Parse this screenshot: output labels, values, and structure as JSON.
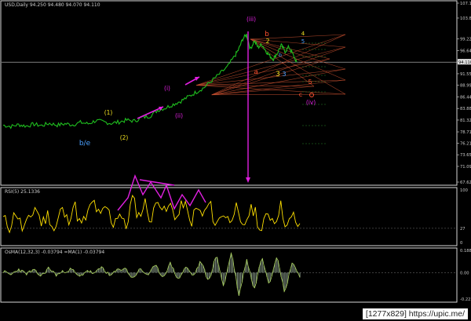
{
  "window": {
    "symbol_header": "USD,Daily  94.250  94.480  94.070  94.110",
    "rsi_header": "RSI(5) 25.1336",
    "macd_header": "OsMA(12,32,3) -0.03794  =MA(1) -0.03794"
  },
  "watermark": "[1277x829] https://upic.me/",
  "colors": {
    "background": "#000000",
    "price_line": "#1fbf1f",
    "rsi_line": "#ffe000",
    "macd_hist": "#7a8a7a",
    "macd_line": "#a8d05a",
    "magenta": "#e020e0",
    "wave_yellow": "#f0e020",
    "wave_blue": "#4aa0ff",
    "wave_red": "#ff5030",
    "fan_lines": "#c85030"
  },
  "chart_data": [
    {
      "type": "line",
      "panel": "price",
      "series_name": "USD Daily close",
      "ylim": [
        67.623,
        107.14
      ],
      "y_ticks": [
        "107.140",
        "103.850",
        "99.225",
        "96.646",
        "94.110",
        "91.552",
        "88.998",
        "86.440",
        "83.880",
        "81.322",
        "78.710",
        "76.210",
        "73.651",
        "71.090",
        "67.623"
      ],
      "current_price_label": "94.110",
      "x": [
        0,
        10,
        20,
        30,
        40,
        50,
        60,
        70,
        80,
        90,
        100,
        110,
        120,
        130,
        140,
        150,
        160,
        170,
        180,
        190,
        200,
        210,
        220,
        230,
        240,
        250,
        260,
        270,
        280,
        290,
        300,
        305,
        310,
        315,
        320,
        325,
        330,
        335,
        340,
        345,
        350,
        355,
        360,
        365,
        370,
        375,
        380
      ],
      "values": [
        80.2,
        79.9,
        80.3,
        80.0,
        80.4,
        80.1,
        80.6,
        80.2,
        80.5,
        80.3,
        80.8,
        80.5,
        81.2,
        80.9,
        80.6,
        80.9,
        81.3,
        81.1,
        81.9,
        82.2,
        83.5,
        84.0,
        84.8,
        85.5,
        86.5,
        87.5,
        88.5,
        90.0,
        91.5,
        93.0,
        95.5,
        97.0,
        99.2,
        100.2,
        97.0,
        98.8,
        97.4,
        98.0,
        96.6,
        95.5,
        94.8,
        96.2,
        97.8,
        96.5,
        97.5,
        95.8,
        94.1
      ],
      "annotations": [
        {
          "text": "(1)",
          "color": "#f0e020"
        },
        {
          "text": "(2)",
          "color": "#f0e020"
        },
        {
          "text": "b/e",
          "color": "#4aa0ff"
        },
        {
          "text": "(i)",
          "color": "#e020e0"
        },
        {
          "text": "(ii)",
          "color": "#e020e0"
        },
        {
          "text": "(iii)",
          "color": "#e020e0"
        },
        {
          "text": "(iv)",
          "color": "#e020e0"
        },
        {
          "text": "a",
          "color": "#ff5030"
        },
        {
          "text": "b",
          "color": "#ff5030"
        },
        {
          "text": "c",
          "color": "#ff5030"
        },
        {
          "text": "2",
          "color": "#f0e020"
        },
        {
          "text": "3",
          "color": "#f0e020"
        },
        {
          "text": "4",
          "color": "#f0e020"
        },
        {
          "text": "5",
          "color": "#4aa0ff"
        },
        {
          "text": "5",
          "color": "#ff5030"
        },
        {
          "text": "b",
          "color": "#4aa0ff"
        },
        {
          "text": "3",
          "color": "#4aa0ff"
        }
      ]
    },
    {
      "type": "line",
      "panel": "rsi",
      "series_name": "RSI(5)",
      "ylim": [
        0,
        100
      ],
      "y_ticks": [
        "100",
        "27",
        "0"
      ],
      "values": [
        45,
        30,
        60,
        25,
        40,
        70,
        35,
        55,
        20,
        65,
        40,
        75,
        30,
        50,
        80,
        45,
        70,
        35,
        60,
        25,
        85,
        50,
        75,
        40,
        90,
        55,
        70,
        45,
        80,
        35,
        65,
        50,
        75,
        30,
        60,
        40,
        70,
        20,
        55,
        65,
        15,
        60,
        40,
        70,
        30,
        50,
        25
      ]
    },
    {
      "type": "bar",
      "panel": "macd",
      "series_name": "OsMA(12,32,3)",
      "ylim": [
        -0.2231,
        0.1884
      ],
      "y_ticks": [
        "0.18843",
        "0.00",
        "-0.22312"
      ],
      "values": [
        0.01,
        -0.02,
        0.03,
        -0.01,
        0.02,
        -0.03,
        0.04,
        -0.02,
        0.01,
        0.03,
        -0.04,
        0.02,
        -0.01,
        0.05,
        -0.03,
        0.02,
        0.04,
        -0.05,
        0.03,
        -0.02,
        0.06,
        -0.04,
        0.08,
        -0.06,
        0.05,
        -0.03,
        0.1,
        -0.08,
        0.15,
        -0.12,
        0.18,
        -0.2,
        0.12,
        -0.15,
        0.14,
        -0.1,
        0.16,
        -0.18,
        0.1,
        -0.04
      ]
    }
  ]
}
